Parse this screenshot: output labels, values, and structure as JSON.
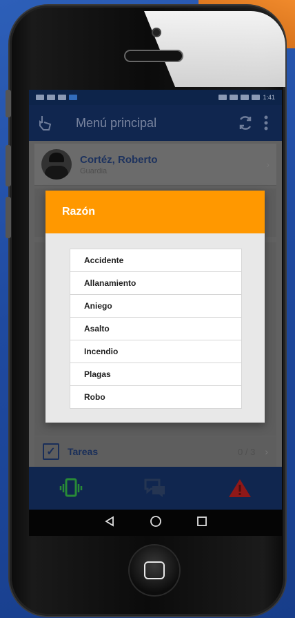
{
  "status_bar": {
    "left_text": "",
    "right_text": "1:41"
  },
  "app_bar": {
    "title": "Menú principal",
    "menu_icon": "hand-tap-icon",
    "refresh_icon": "refresh-icon",
    "more_icon": "more-vert-icon"
  },
  "user": {
    "name": "Cortéz, Roberto",
    "role": "Guardia"
  },
  "tareas": {
    "label": "Tareas",
    "count": "0 / 3"
  },
  "dialog": {
    "title": "Razón",
    "options": [
      "Accidente",
      "Allanamiento",
      "Aniego",
      "Asalto",
      "Incendio",
      "Plagas",
      "Robo"
    ]
  },
  "bottom_nav": {
    "items": [
      "vibrate-phone-icon",
      "chat-icon",
      "alert-triangle-icon"
    ]
  },
  "colors": {
    "accent": "#ff9800",
    "primary": "#132c5a",
    "alert": "#c0392b",
    "ok": "#2e9e3f"
  }
}
